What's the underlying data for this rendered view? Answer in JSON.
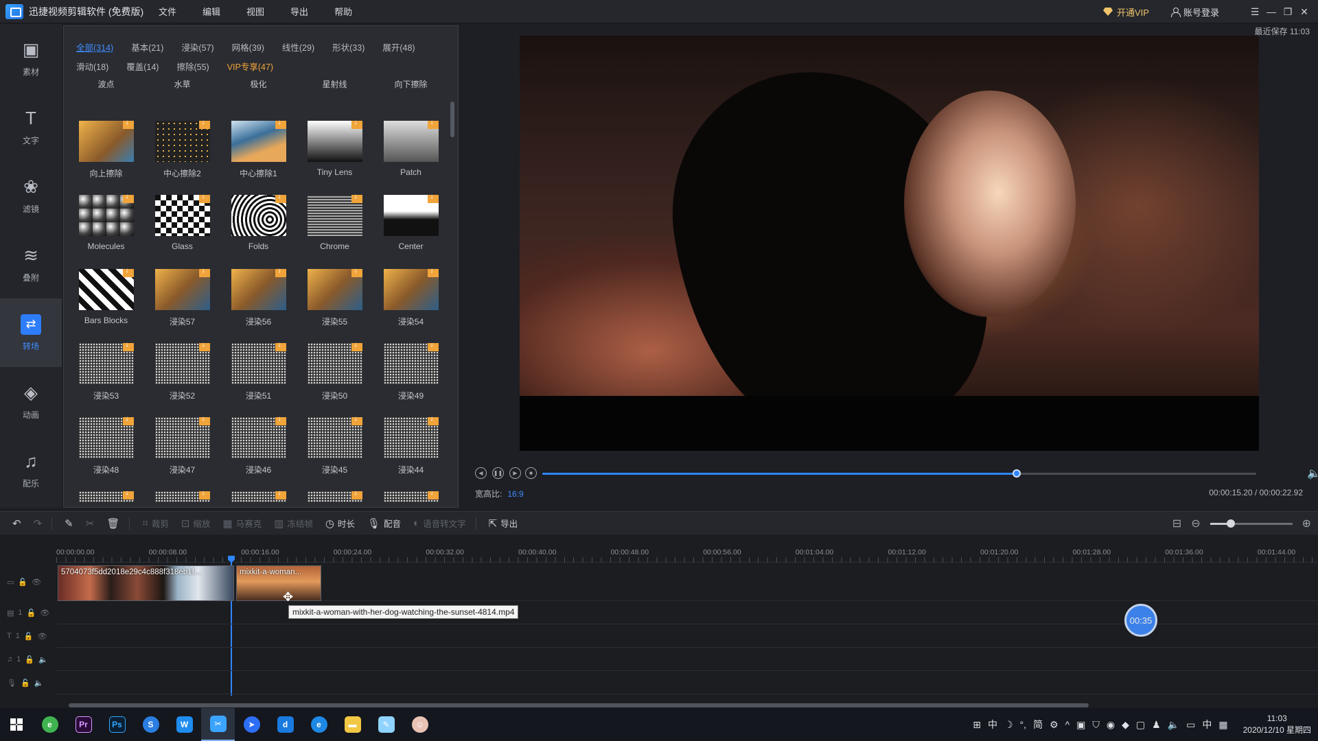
{
  "window": {
    "title": "迅捷视频剪辑软件 (免费版)",
    "menu": [
      "文件",
      "编辑",
      "视图",
      "导出",
      "帮助"
    ],
    "vip_label": "开通VIP",
    "login_label": "账号登录"
  },
  "sidebar": {
    "items": [
      {
        "label": "素材",
        "icon": "folder-play-icon"
      },
      {
        "label": "文字",
        "icon": "text-icon"
      },
      {
        "label": "滤镜",
        "icon": "filter-icon"
      },
      {
        "label": "叠附",
        "icon": "layers-icon"
      },
      {
        "label": "转场",
        "icon": "transition-icon",
        "active": true
      },
      {
        "label": "动画",
        "icon": "animation-icon"
      },
      {
        "label": "配乐",
        "icon": "music-note-icon"
      }
    ]
  },
  "transitions": {
    "categories": [
      "全部(314)",
      "基本(21)",
      "浸染(57)",
      "网格(39)",
      "线性(29)",
      "形状(33)",
      "展开(48)",
      "滑动(18)",
      "覆盖(14)",
      "擦除(55)",
      "VIP专享(47)"
    ],
    "active_category": "全部(314)",
    "top_row": [
      "波点",
      "水草",
      "极化",
      "星射线",
      "向下擦除"
    ],
    "items": [
      "向上擦除",
      "中心擦除2",
      "中心擦除1",
      "Tiny Lens",
      "Patch",
      "Molecules",
      "Glass",
      "Folds",
      "Chrome",
      "Center",
      "Bars Blocks",
      "浸染57",
      "浸染56",
      "浸染55",
      "浸染54",
      "浸染53",
      "浸染52",
      "浸染51",
      "浸染50",
      "浸染49",
      "浸染48",
      "浸染47",
      "浸染46",
      "浸染45",
      "浸染44"
    ]
  },
  "preview": {
    "last_saved": "最近保存 11:03",
    "aspect_label": "宽高比:",
    "aspect_value": "16:9",
    "timecode": "00:00:15.20 / 00:00:22.92",
    "progress": 0.664
  },
  "toolbar": {
    "tools": [
      "裁剪",
      "缩放",
      "马赛克",
      "冻结帧",
      "时长",
      "配音",
      "语音转文字",
      "导出"
    ],
    "zoom_level": 0.25
  },
  "timeline": {
    "ruler": [
      "00:00:00.00",
      "00:00:08.00",
      "00:00:16.00",
      "00:00:24.00",
      "00:00:32.00",
      "00:00:40.00",
      "00:00:48.00",
      "00:00:56.00",
      "00:01:04.00",
      "00:01:12.00",
      "00:01:20.00",
      "00:01:28.00",
      "00:01:36.00",
      "00:01:44.00"
    ],
    "clips": [
      {
        "name": "5704073f5dd2018e29c4c888f318eb1f..."
      },
      {
        "name": "mixkit-a-woman..."
      }
    ],
    "tooltip": "mixkit-a-woman-with-her-dog-watching-the-sunset-4814.mp4",
    "badge": "00:35",
    "track_numbers": [
      "1",
      "1",
      "1",
      "1"
    ]
  },
  "taskbar": {
    "time": "11:03",
    "date": "2020/12/10 星期四",
    "ime": "中",
    "lang": "中",
    "simplified": "简"
  }
}
